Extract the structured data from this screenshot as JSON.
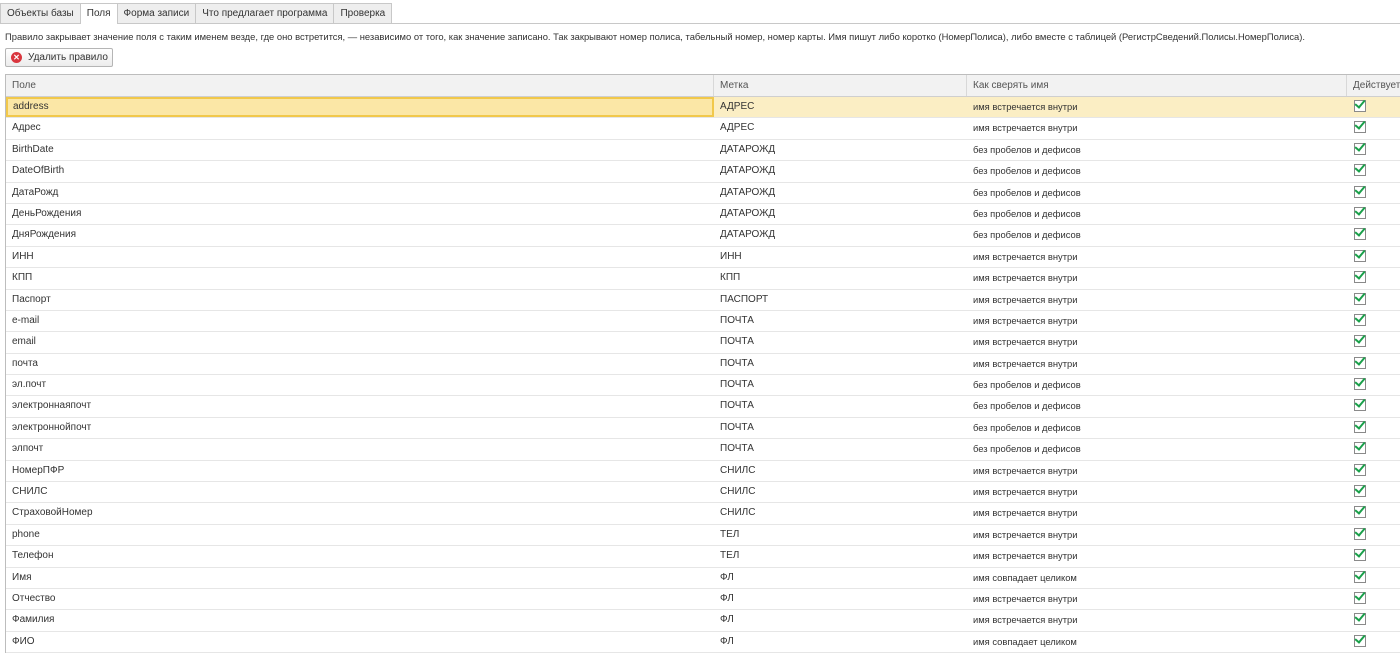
{
  "tabs": [
    {
      "label": "Объекты базы",
      "active": false
    },
    {
      "label": "Поля",
      "active": true
    },
    {
      "label": "Форма записи",
      "active": false
    },
    {
      "label": "Что предлагает программа",
      "active": false
    },
    {
      "label": "Проверка",
      "active": false
    }
  ],
  "description": "Правило закрывает значение поля с таким именем везде, где оно встретится, — независимо от того, как значение записано. Так закрывают номер полиса, табельный номер, номер карты. Имя пишут либо коротко (НомерПолиса), либо вместе с таблицей (РегистрСведений.Полисы.НомерПолиса).",
  "toolbar": {
    "delete_label": "Удалить правило",
    "delete_icon": "delete-icon"
  },
  "table": {
    "columns": [
      "Поле",
      "Метка",
      "Как сверять имя",
      "Действует"
    ],
    "selected_row": 0,
    "rows": [
      {
        "field": "address",
        "label": "АДРЕС",
        "match": "имя встречается внутри",
        "active": true
      },
      {
        "field": "Адрес",
        "label": "АДРЕС",
        "match": "имя встречается внутри",
        "active": true
      },
      {
        "field": "BirthDate",
        "label": "ДАТАРОЖД",
        "match": "без пробелов и дефисов",
        "active": true
      },
      {
        "field": "DateOfBirth",
        "label": "ДАТАРОЖД",
        "match": "без пробелов и дефисов",
        "active": true
      },
      {
        "field": "ДатаРожд",
        "label": "ДАТАРОЖД",
        "match": "без пробелов и дефисов",
        "active": true
      },
      {
        "field": "ДеньРождения",
        "label": "ДАТАРОЖД",
        "match": "без пробелов и дефисов",
        "active": true
      },
      {
        "field": "ДняРождения",
        "label": "ДАТАРОЖД",
        "match": "без пробелов и дефисов",
        "active": true
      },
      {
        "field": "ИНН",
        "label": "ИНН",
        "match": "имя встречается внутри",
        "active": true
      },
      {
        "field": "КПП",
        "label": "КПП",
        "match": "имя встречается внутри",
        "active": true
      },
      {
        "field": "Паспорт",
        "label": "ПАСПОРТ",
        "match": "имя встречается внутри",
        "active": true
      },
      {
        "field": "e-mail",
        "label": "ПОЧТА",
        "match": "имя встречается внутри",
        "active": true
      },
      {
        "field": "email",
        "label": "ПОЧТА",
        "match": "имя встречается внутри",
        "active": true
      },
      {
        "field": "почта",
        "label": "ПОЧТА",
        "match": "имя встречается внутри",
        "active": true
      },
      {
        "field": "эл.почт",
        "label": "ПОЧТА",
        "match": "без пробелов и дефисов",
        "active": true
      },
      {
        "field": "электроннаяпочт",
        "label": "ПОЧТА",
        "match": "без пробелов и дефисов",
        "active": true
      },
      {
        "field": "электроннойпочт",
        "label": "ПОЧТА",
        "match": "без пробелов и дефисов",
        "active": true
      },
      {
        "field": "элпочт",
        "label": "ПОЧТА",
        "match": "без пробелов и дефисов",
        "active": true
      },
      {
        "field": "НомерПФР",
        "label": "СНИЛС",
        "match": "имя встречается внутри",
        "active": true
      },
      {
        "field": "СНИЛС",
        "label": "СНИЛС",
        "match": "имя встречается внутри",
        "active": true
      },
      {
        "field": "СтраховойНомер",
        "label": "СНИЛС",
        "match": "имя встречается внутри",
        "active": true
      },
      {
        "field": "phone",
        "label": "ТЕЛ",
        "match": "имя встречается внутри",
        "active": true
      },
      {
        "field": "Телефон",
        "label": "ТЕЛ",
        "match": "имя встречается внутри",
        "active": true
      },
      {
        "field": "Имя",
        "label": "ФЛ",
        "match": "имя совпадает целиком",
        "active": true
      },
      {
        "field": "Отчество",
        "label": "ФЛ",
        "match": "имя встречается внутри",
        "active": true
      },
      {
        "field": "Фамилия",
        "label": "ФЛ",
        "match": "имя встречается внутри",
        "active": true
      },
      {
        "field": "ФИО",
        "label": "ФЛ",
        "match": "имя совпадает целиком",
        "active": true
      }
    ]
  }
}
